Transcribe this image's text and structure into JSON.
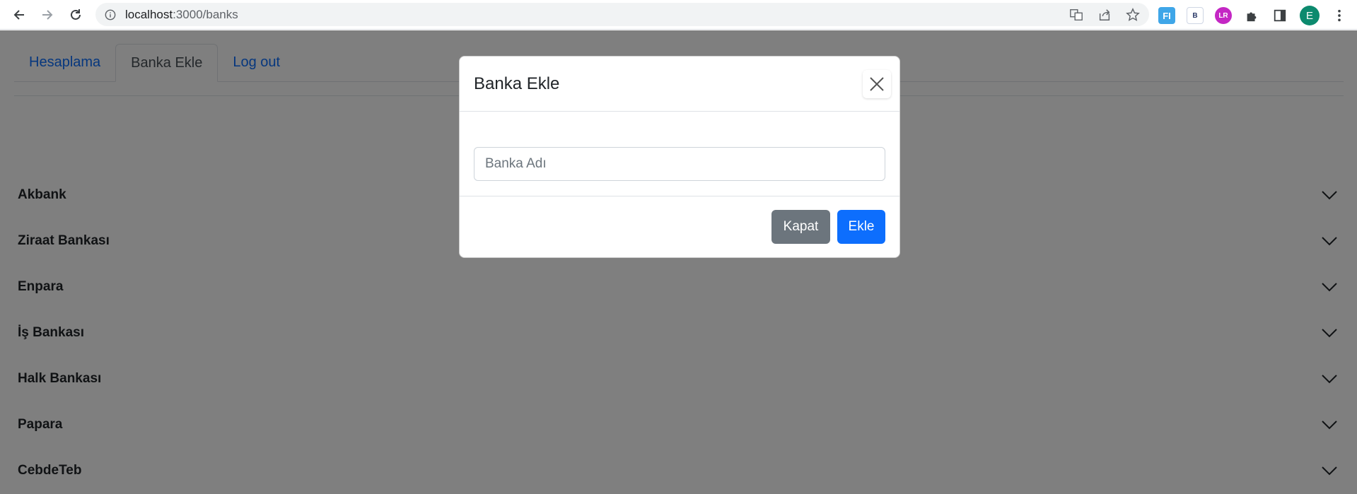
{
  "browser": {
    "url_host": "localhost",
    "url_path": ":3000/banks",
    "profile_initial": "E",
    "extensions": [
      "FI",
      "B",
      "LR"
    ]
  },
  "tabs": [
    {
      "label": "Hesaplama"
    },
    {
      "label": "Banka Ekle"
    },
    {
      "label": "Log out"
    }
  ],
  "banks": [
    {
      "name": "Akbank"
    },
    {
      "name": "Ziraat Bankası"
    },
    {
      "name": "Enpara"
    },
    {
      "name": "İş Bankası"
    },
    {
      "name": "Halk Bankası"
    },
    {
      "name": "Papara"
    },
    {
      "name": "CebdeTeb"
    }
  ],
  "modal": {
    "title": "Banka Ekle",
    "input_placeholder": "Banka Adı",
    "input_value": "",
    "close_label": "Kapat",
    "add_label": "Ekle"
  },
  "colors": {
    "primary": "#0d6efd",
    "secondary": "#6c757d",
    "backdrop": "rgba(0,0,0,0.5)"
  }
}
